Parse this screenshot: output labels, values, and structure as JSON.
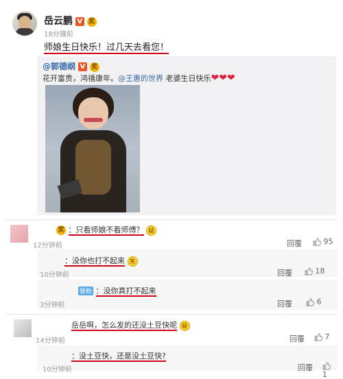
{
  "post": {
    "author": "岳云鹏",
    "time": "18分鐘前",
    "text": "师娘生日快乐！过几天去看您！",
    "v_badge": "V",
    "medal_badge": "奖"
  },
  "quote": {
    "author": "@郭德纲",
    "v_badge": "V",
    "medal_badge": "奖",
    "text_before_link": "花开富贵，鸿禧康年。",
    "link_text": "@王惠的世界",
    "text_after_link": " 老婆生日快乐",
    "hearts": "❤❤❤"
  },
  "comments": [
    {
      "text": "：只看师娘不看师傅？",
      "emoji": "疑",
      "time": "12分钟前",
      "reply_label": "回覆",
      "likes": "95",
      "replies": [
        {
          "text": "：没你也打不起来",
          "emoji": "笑",
          "time": "10分钟前",
          "reply_label": "回覆",
          "likes": "18"
        },
        {
          "tag": "铁粉",
          "text": "：没你真打不起来",
          "time": "3分钟前",
          "reply_label": "回覆",
          "likes": "6"
        }
      ]
    },
    {
      "text": "岳岳啊，怎么发的还没土豆快呢",
      "emoji": "疑",
      "time": "14分钟前",
      "reply_label": "回覆",
      "likes": "7",
      "replies": [
        {
          "text": "：没土豆快，还是没土豆快?",
          "time": "10分钟前",
          "reply_label": "回覆",
          "likes": "1"
        }
      ]
    }
  ],
  "colors": {
    "accent_red": "#d0021b",
    "link_blue": "#3a69a8",
    "heart_red": "#e0233a"
  }
}
